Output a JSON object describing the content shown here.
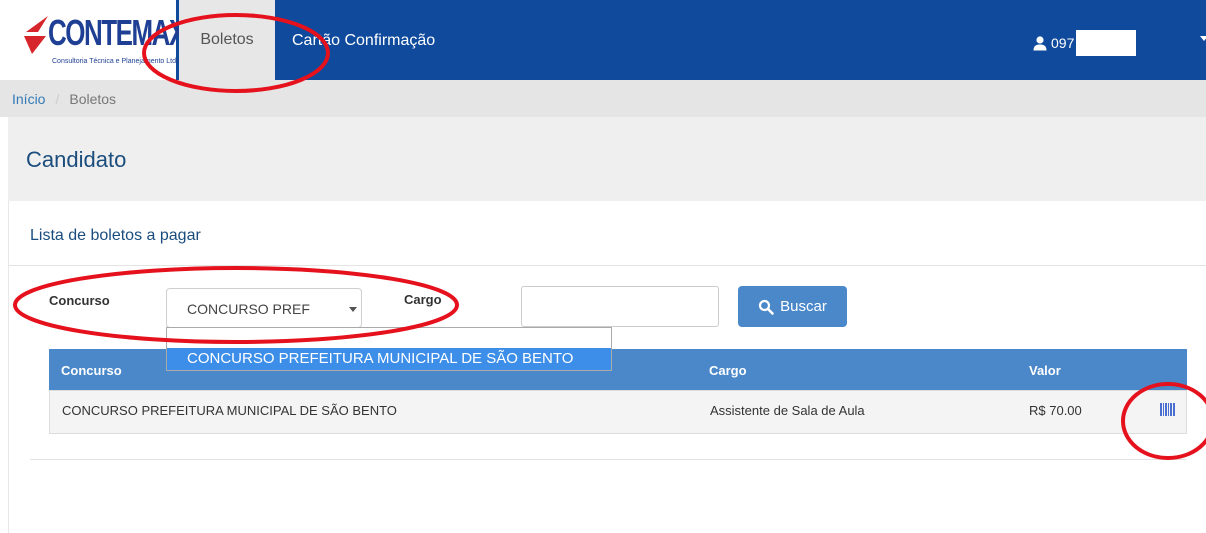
{
  "app": {
    "logo_text": "CONTEMAX",
    "logo_subtext": "Consultoria Técnica e Planejamento Ltda"
  },
  "nav": {
    "tab_active": "Boletos",
    "link_2": "Cartão Confirmação",
    "user_id": "097"
  },
  "breadcrumb": {
    "home": "Início",
    "separator": "/",
    "current": "Boletos"
  },
  "page": {
    "title": "Candidato"
  },
  "panel": {
    "title": "Lista de boletos a pagar"
  },
  "filters": {
    "concurso_label": "Concurso",
    "concurso_selected": "CONCURSO PREF",
    "cargo_label": "Cargo",
    "cargo_value": "",
    "search_button": "Buscar"
  },
  "dropdown": {
    "options": [
      "CONCURSO PREFEITURA MUNICIPAL DE SÃO BENTO"
    ]
  },
  "table": {
    "headers": [
      "Concurso",
      "Cargo",
      "Valor"
    ],
    "rows": [
      {
        "concurso": "CONCURSO PREFEITURA MUNICIPAL DE SÃO BENTO",
        "cargo": "Assistente de Sala de Aula",
        "valor": "R$ 70.00"
      }
    ]
  },
  "colors": {
    "navbar": "#0f4a9c",
    "primary": "#4a88c9",
    "annotation": "#e5121d",
    "dropdown_highlight": "#3c8ee8"
  },
  "icons": [
    "user-icon",
    "search-icon",
    "barcode-icon",
    "caret-down-icon"
  ]
}
